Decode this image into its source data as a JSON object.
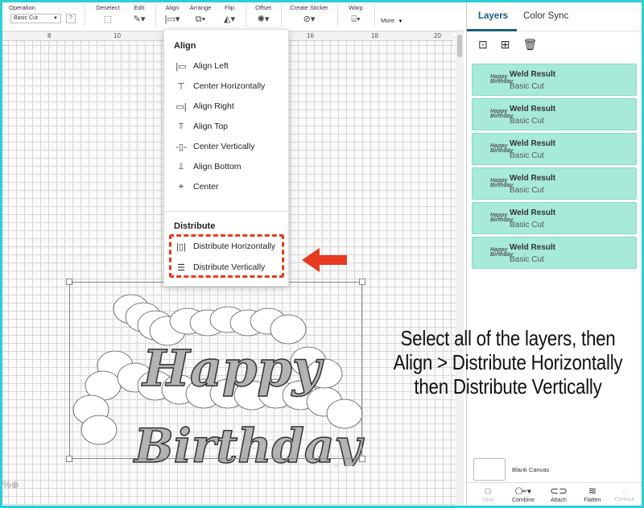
{
  "toolbar": {
    "operation_label": "Operation",
    "operation_value": "Basic Cut",
    "help": "?",
    "deselect": "Deselect",
    "edit": "Edit",
    "align": "Align",
    "arrange": "Arrange",
    "flip": "Flip",
    "offset": "Offset",
    "create_sticker": "Create Sticker",
    "warp": "Warp",
    "more": "More"
  },
  "ruler": {
    "ticks": [
      "8",
      "10",
      "16",
      "18",
      "20"
    ]
  },
  "align_menu": {
    "align_title": "Align",
    "items": [
      "Align Left",
      "Center Horizontally",
      "Align Right",
      "Align Top",
      "Center Vertically",
      "Align Bottom",
      "Center"
    ],
    "distribute_title": "Distribute",
    "distribute_items": [
      "Distribute Horizontally",
      "Distribute Vertically"
    ]
  },
  "design": {
    "line1": "Happy",
    "line2": "Birthday"
  },
  "instruction": {
    "line1": "Select all of the layers, then",
    "line2": "Align > Distribute Horizontally",
    "line3": "then Distribute Vertically"
  },
  "panel": {
    "tabs": [
      "Layers",
      "Color Sync"
    ],
    "layers": [
      {
        "name": "Weld Result",
        "sub": "Basic Cut"
      },
      {
        "name": "Weld Result",
        "sub": "Basic Cut"
      },
      {
        "name": "Weld Result",
        "sub": "Basic Cut"
      },
      {
        "name": "Weld Result",
        "sub": "Basic Cut"
      },
      {
        "name": "Weld Result",
        "sub": "Basic Cut"
      },
      {
        "name": "Weld Result",
        "sub": "Basic Cut"
      }
    ],
    "layer_thumb_text": "Happy Birthday",
    "blank_canvas": "Blank Canvas",
    "bottom": [
      "Slice",
      "Combine",
      "Attach",
      "Flatten",
      "Contour"
    ]
  },
  "colors": {
    "accent": "#1a5f7a",
    "layer_bg": "#a7ead8",
    "highlight": "#e53a1f",
    "frame": "#2ecfd3"
  }
}
